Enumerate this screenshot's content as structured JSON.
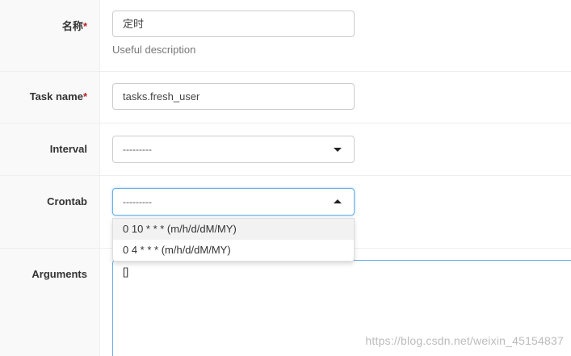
{
  "fields": {
    "name": {
      "label": "名称",
      "required_mark": "*",
      "value": "定时",
      "help": "Useful description"
    },
    "task_name": {
      "label": "Task name",
      "required_mark": "*",
      "value": "tasks.fresh_user"
    },
    "interval": {
      "label": "Interval",
      "selected": "---------"
    },
    "crontab": {
      "label": "Crontab",
      "selected": "---------",
      "options": [
        "0 10 * * * (m/h/d/dM/MY)",
        "0 4 * * * (m/h/d/dM/MY)"
      ]
    },
    "arguments": {
      "label": "Arguments",
      "value": "[]"
    }
  },
  "watermark": "https://blog.csdn.net/weixin_45154837",
  "colors": {
    "required": "#ba2121",
    "focus_border": "#66afe9",
    "label_bg": "#f9f9f9"
  }
}
